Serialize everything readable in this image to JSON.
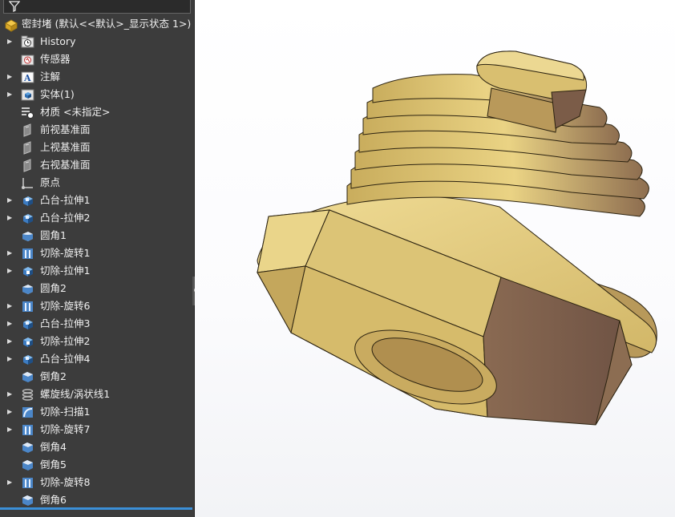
{
  "feature_tree": {
    "root": {
      "label": "密封堵 (默认<<默认>_显示状态 1>)",
      "icon": "part-icon"
    },
    "items": [
      {
        "label": "History",
        "icon": "history-folder-icon",
        "expandable": true
      },
      {
        "label": "传感器",
        "icon": "sensors-icon",
        "expandable": false
      },
      {
        "label": "注解",
        "icon": "annotations-icon",
        "expandable": true
      },
      {
        "label": "实体(1)",
        "icon": "solid-bodies-icon",
        "expandable": true
      },
      {
        "label": "材质 <未指定>",
        "icon": "material-icon",
        "expandable": false
      },
      {
        "label": "前视基准面",
        "icon": "plane-icon",
        "expandable": false
      },
      {
        "label": "上视基准面",
        "icon": "plane-icon",
        "expandable": false
      },
      {
        "label": "右视基准面",
        "icon": "plane-icon",
        "expandable": false
      },
      {
        "label": "原点",
        "icon": "origin-icon",
        "expandable": false
      },
      {
        "label": "凸台-拉伸1",
        "icon": "boss-extrude-icon",
        "expandable": true
      },
      {
        "label": "凸台-拉伸2",
        "icon": "boss-extrude-icon",
        "expandable": true
      },
      {
        "label": "圆角1",
        "icon": "fillet-icon",
        "expandable": false
      },
      {
        "label": "切除-旋转1",
        "icon": "cut-revolve-icon",
        "expandable": true
      },
      {
        "label": "切除-拉伸1",
        "icon": "cut-extrude-icon",
        "expandable": true
      },
      {
        "label": "圆角2",
        "icon": "fillet-icon",
        "expandable": false
      },
      {
        "label": "切除-旋转6",
        "icon": "cut-revolve-icon",
        "expandable": true
      },
      {
        "label": "凸台-拉伸3",
        "icon": "boss-extrude-icon",
        "expandable": true
      },
      {
        "label": "切除-拉伸2",
        "icon": "cut-extrude-icon",
        "expandable": true
      },
      {
        "label": "凸台-拉伸4",
        "icon": "boss-extrude-icon",
        "expandable": true
      },
      {
        "label": "倒角2",
        "icon": "chamfer-icon",
        "expandable": false
      },
      {
        "label": "螺旋线/涡状线1",
        "icon": "helix-icon",
        "expandable": true
      },
      {
        "label": "切除-扫描1",
        "icon": "cut-sweep-icon",
        "expandable": true
      },
      {
        "label": "切除-旋转7",
        "icon": "cut-revolve-icon",
        "expandable": true
      },
      {
        "label": "倒角4",
        "icon": "chamfer-icon",
        "expandable": false
      },
      {
        "label": "倒角5",
        "icon": "chamfer-icon",
        "expandable": false
      },
      {
        "label": "切除-旋转8",
        "icon": "cut-revolve-icon",
        "expandable": true
      },
      {
        "label": "倒角6",
        "icon": "chamfer-icon",
        "expandable": false
      }
    ]
  },
  "colors": {
    "panel_bg": "#3c3c3c",
    "text": "#f0f0f0",
    "accent": "#3b8fd8",
    "brass_light": "#e3cd7f",
    "brass_mid": "#c9ad5d",
    "brass_dark": "#7a5c49"
  }
}
